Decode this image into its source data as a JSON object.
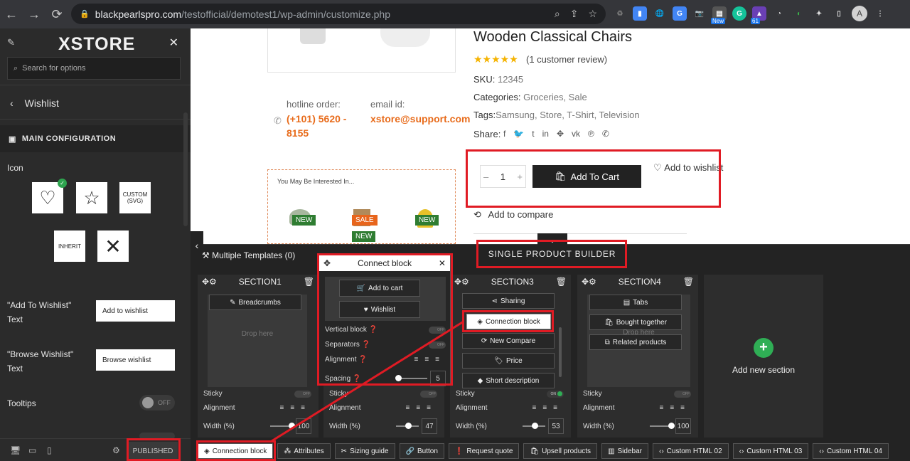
{
  "browser": {
    "url_host": "blackpearlspro.com",
    "url_path": "/testofficial/demotest1/wp-admin/customize.php",
    "ext_badge_new": "New",
    "ext_badge_count": "61",
    "avatar_letter": "A"
  },
  "sidebar": {
    "brand": "XSTORE",
    "search_placeholder": "Search for options",
    "panel_title": "Wishlist",
    "section_title": "MAIN CONFIGURATION",
    "icon_label": "Icon",
    "icon_custom": "CUSTOM (SVG)",
    "icon_inherit": "INHERIT",
    "add_label": "\"Add To Wishlist\" Text",
    "add_value": "Add to wishlist",
    "browse_label": "\"Browse Wishlist\" Text",
    "browse_value": "Browse wishlist",
    "tooltips_label": "Tooltips",
    "tooltips_state": "OFF",
    "published": "PUBLISHED"
  },
  "product": {
    "title": "Wooden Classical Chairs",
    "stars": "★★★★★",
    "review": "(1 customer review)",
    "sku_label": "SKU:",
    "sku": "12345",
    "cat_label": "Categories:",
    "categories": "Groceries, Sale",
    "tags_label": "Tags:",
    "tags": "Samsung, Store, T-Shirt, Television",
    "share_label": "Share:",
    "hotline_label": "hotline order:",
    "hotline": "(+101) 5620 - 8155",
    "email_label": "email id:",
    "email": "xstore@support.com",
    "interest_title": "You May Be Interested In...",
    "badge_new": "NEW",
    "badge_sale": "SALE",
    "qty": "1",
    "add_to_cart": "Add To Cart",
    "wishlist": "Add to wishlist",
    "compare": "Add to compare"
  },
  "builder": {
    "multi_templates": "Multiple Templates (0)",
    "title": "SINGLE PRODUCT BUILDER",
    "drop_here": "Drop here",
    "sticky": "Sticky",
    "alignment": "Alignment",
    "width": "Width (%)",
    "off": "OFF",
    "on": "ON",
    "add_section": "Add new section",
    "sections": [
      {
        "name": "SECTION1",
        "width": "100",
        "chips": [
          "Breadcrumbs"
        ]
      },
      {
        "name": "SECTION2",
        "width": "47"
      },
      {
        "name": "SECTION3",
        "width": "53",
        "chips": [
          "Sharing",
          "Connection block",
          "New Compare",
          "Price",
          "Short description"
        ]
      },
      {
        "name": "SECTION4",
        "width": "100",
        "chips": [
          "Tabs",
          "Bought together",
          "Related products"
        ]
      }
    ],
    "connect": {
      "title": "Connect block",
      "add_to_cart": "Add to cart",
      "wishlist": "Wishlist",
      "vertical": "Vertical block",
      "separators": "Separators",
      "alignment": "Alignment",
      "spacing": "Spacing",
      "spacing_value": "5"
    },
    "bottom": [
      "Connection block",
      "Attributes",
      "Sizing guide",
      "Button",
      "Request quote",
      "Upsell products",
      "Sidebar",
      "Custom HTML 02",
      "Custom HTML 03",
      "Custom HTML 04"
    ]
  },
  "colors": {
    "highlight": "#e01b24",
    "accent": "#e86c1c",
    "add_green": "#2fae55"
  }
}
